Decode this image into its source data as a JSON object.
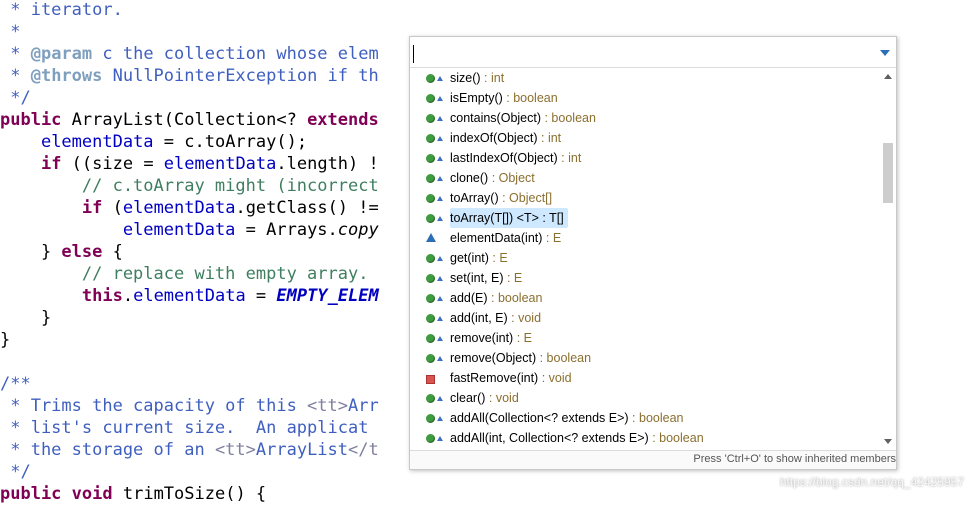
{
  "code": {
    "l1": " * iterator.",
    "l2": " *",
    "l3_a": " * ",
    "l3_tag": "@param",
    "l3_b": " c the collection whose elem",
    "l4_a": " * ",
    "l4_tag": "@throws",
    "l4_b": " NullPointerException if th",
    "l5": " */",
    "l6_kw": "public",
    "l6_b": " ArrayList(Collection<? ",
    "l6_kw2": "extends",
    "l7_a": "    ",
    "l7_f": "elementData",
    "l7_b": " = c.toArray();",
    "l8_a": "    ",
    "l8_kw": "if",
    "l8_b": " ((size = ",
    "l8_f": "elementData",
    "l8_c": ".length) !",
    "l9": "        // c.toArray might (incorrect",
    "l10_a": "        ",
    "l10_kw": "if",
    "l10_b": " (",
    "l10_f": "elementData",
    "l10_c": ".getClass() !=",
    "l11_a": "            ",
    "l11_f": "elementData",
    "l11_b": " = Arrays.",
    "l11_it": "copy",
    "l12_a": "    } ",
    "l12_kw": "else",
    "l12_b": " {",
    "l13": "        // replace with empty array.",
    "l14_a": "        ",
    "l14_kw": "this",
    "l14_b": ".",
    "l14_f": "elementData",
    "l14_c": " = ",
    "l14_s": "EMPTY_ELEM",
    "l15": "    }",
    "l16": "}",
    "l18": "/**",
    "l19_a": " * Trims the capacity of this ",
    "l19_tt": "<tt>",
    "l19_b": "Arr",
    "l20": " * list's current size.  An applicat",
    "l21_a": " * the storage of an ",
    "l21_tt": "<tt>",
    "l21_b": "ArrayList",
    "l21_tt2": "</t",
    "l22": " */",
    "l23_kw": "public",
    "l23_kw2": "void",
    "l23_b": " trimToSize() {"
  },
  "popup": {
    "filter_value": "",
    "status": "Press 'Ctrl+O' to show inherited members",
    "items": [
      {
        "name": "size()",
        "ret": " : int"
      },
      {
        "name": "isEmpty()",
        "ret": " : boolean"
      },
      {
        "name": "contains(Object)",
        "ret": " : boolean"
      },
      {
        "name": "indexOf(Object)",
        "ret": " : int"
      },
      {
        "name": "lastIndexOf(Object)",
        "ret": " : int"
      },
      {
        "name": "clone()",
        "ret": " : Object"
      },
      {
        "name": "toArray()",
        "ret": " : Object[]"
      },
      {
        "name": "toArray(T[]) <T> : T[]",
        "ret": ""
      },
      {
        "name": "elementData(int)",
        "ret": " : E"
      },
      {
        "name": "get(int)",
        "ret": " : E"
      },
      {
        "name": "set(int, E)",
        "ret": " : E"
      },
      {
        "name": "add(E)",
        "ret": " : boolean"
      },
      {
        "name": "add(int, E)",
        "ret": " : void"
      },
      {
        "name": "remove(int)",
        "ret": " : E"
      },
      {
        "name": "remove(Object)",
        "ret": " : boolean"
      },
      {
        "name": "fastRemove(int)",
        "ret": " : void"
      },
      {
        "name": "clear()",
        "ret": " : void"
      },
      {
        "name": "addAll(Collection<? extends E>)",
        "ret": " : boolean"
      },
      {
        "name": "addAll(int, Collection<? extends E>)",
        "ret": " : boolean"
      }
    ],
    "icons": [
      "public-method-icon",
      "public-method-icon",
      "public-method-icon",
      "public-method-icon",
      "public-method-icon",
      "public-method-icon",
      "public-method-icon",
      "public-method-icon",
      "default-method-icon",
      "public-method-icon",
      "public-method-icon",
      "public-method-icon",
      "public-method-icon",
      "public-method-icon",
      "public-method-icon",
      "private-method-icon",
      "public-method-icon",
      "public-method-icon",
      "public-method-icon"
    ],
    "selected_index": 7
  },
  "watermark": "https://blog.csdn.net/qq_42425957",
  "colors": {
    "keyword": "#7f0055",
    "javadoc": "#3f5fbf",
    "comment": "#3f7f5f",
    "field": "#0000c0",
    "selection": "#cde8ff"
  }
}
